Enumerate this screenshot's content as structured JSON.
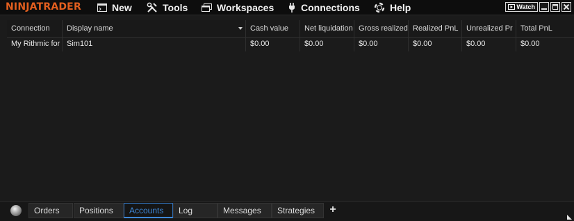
{
  "app": {
    "logo": "NINJATRADER"
  },
  "menu": [
    {
      "label": "New",
      "icon": "new-window-icon"
    },
    {
      "label": "Tools",
      "icon": "tools-icon"
    },
    {
      "label": "Workspaces",
      "icon": "workspaces-icon"
    },
    {
      "label": "Connections",
      "icon": "plug-icon"
    },
    {
      "label": "Help",
      "icon": "help-lifebuoy-icon"
    }
  ],
  "window_controls": {
    "watch_label": "Watch"
  },
  "accounts_grid": {
    "columns": [
      "Connection",
      "Display name",
      "Cash value",
      "Net liquidation",
      "Gross realized",
      "Realized PnL",
      "Unrealized Pr",
      "Total PnL"
    ],
    "rows": [
      [
        "My Rithmic for",
        "Sim101",
        "$0.00",
        "$0.00",
        "$0.00",
        "$0.00",
        "$0.00",
        "$0.00"
      ]
    ]
  },
  "tabs": [
    {
      "label": "Orders",
      "active": false
    },
    {
      "label": "Positions",
      "active": false
    },
    {
      "label": "Accounts",
      "active": true
    },
    {
      "label": "Log",
      "active": false
    },
    {
      "label": "Messages",
      "active": false
    },
    {
      "label": "Strategies",
      "active": false
    }
  ],
  "add_tab_label": "+",
  "colors": {
    "logo": "#e35f1f",
    "active_tab": "#3e88d8",
    "background": "#1b1b1b"
  }
}
